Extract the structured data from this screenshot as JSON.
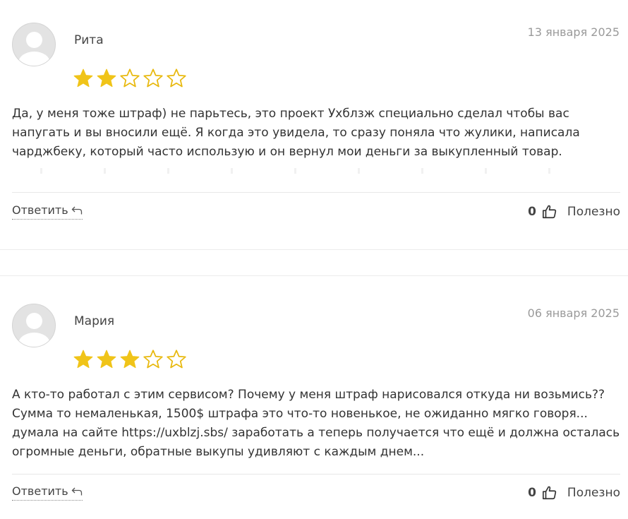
{
  "colors": {
    "star_filled": "#f0c419",
    "star_empty_stroke": "#e8b90f",
    "text": "#333333",
    "date": "#9a9a9a"
  },
  "reviews": [
    {
      "author": "Рита",
      "date": "13 января 2025",
      "rating": 2,
      "max_rating": 5,
      "text": "Да, у меня тоже штраф) не парьтесь, это проект Ухблзж специально сделал чтобы вас напугать и вы вносили ещё. Я когда это увидела, то сразу поняла что жулики, написала чарджбеку, который часто использую и он вернул мои деньги за выкупленный товар.",
      "reply_label": "Ответить",
      "helpful_count": "0",
      "helpful_label": "Полезно"
    },
    {
      "author": "Мария",
      "date": "06 января 2025",
      "rating": 3,
      "max_rating": 5,
      "text": "А кто-то работал с этим сервисом? Почему у меня штраф нарисовался откуда ни возьмись?? Сумма то немаленькая, 1500$ штрафа это что-то новенькое, не ожиданно мягко говоря... думала на сайте https://uxblzj.sbs/ заработать а теперь получается что ещё и должна осталась огромные деньги, обратные выкупы удивляют с каждым днем...",
      "reply_label": "Ответить",
      "helpful_count": "0",
      "helpful_label": "Полезно"
    }
  ],
  "icons": {
    "avatar": "user-avatar-icon",
    "star": "star-icon",
    "reply": "reply-arrow-icon",
    "helpful": "thumbs-up-icon"
  }
}
